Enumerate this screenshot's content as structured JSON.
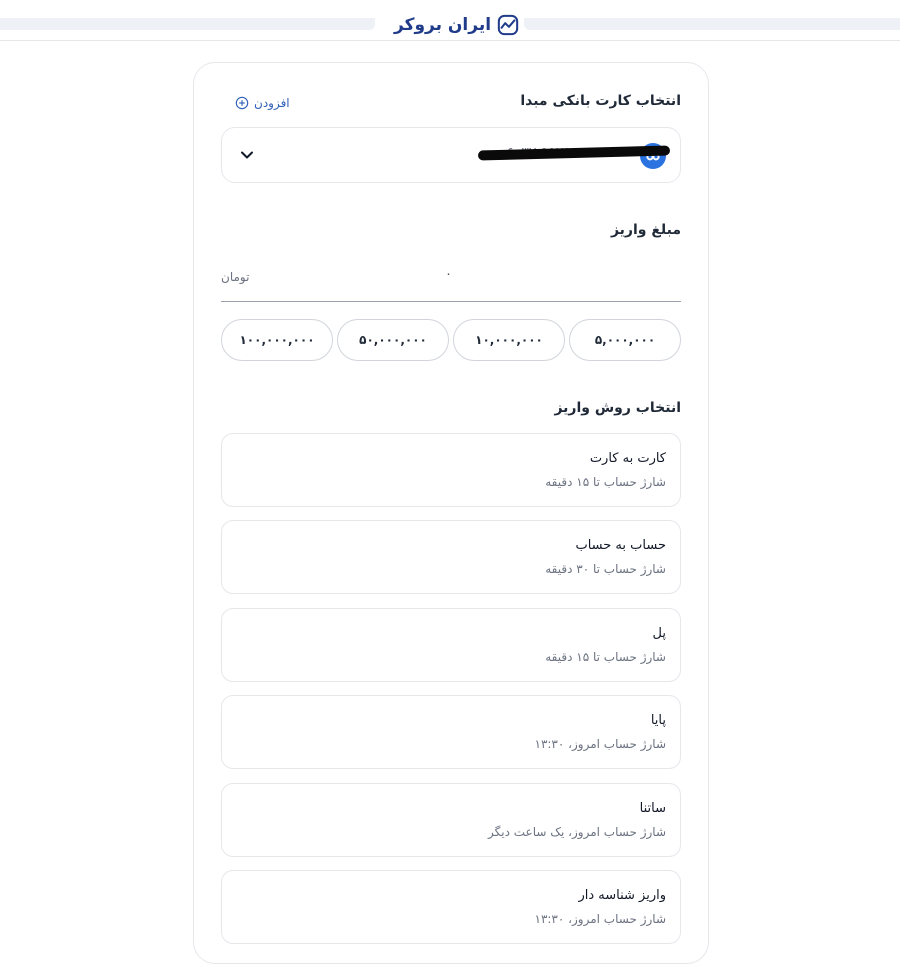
{
  "header": {
    "logo_text": "ایران بروکر",
    "logo_icon": "chart-trend-icon"
  },
  "source_card": {
    "title": "انتخاب کارت بانکی مبدا",
    "add_label": "افزودن",
    "card_number_masked": "۶۰۳۷ ۹۹۷۹ ۰۰۰۰ ۰۰۰۰",
    "bank_icon": "bank-logo-icon"
  },
  "deposit_amount": {
    "title": "مبلغ واریز",
    "value": "۰",
    "unit": "تومان",
    "presets": [
      "۵,۰۰۰,۰۰۰",
      "۱۰,۰۰۰,۰۰۰",
      "۵۰,۰۰۰,۰۰۰",
      "۱۰۰,۰۰۰,۰۰۰"
    ]
  },
  "deposit_method": {
    "title": "انتخاب روش واریز",
    "options": [
      {
        "name": "کارت به کارت",
        "desc": "شارژ حساب تا ۱۵ دقیقه"
      },
      {
        "name": "حساب به حساب",
        "desc": "شارژ حساب تا ۳۰ دقیقه"
      },
      {
        "name": "پل",
        "desc": "شارژ حساب تا ۱۵ دقیقه"
      },
      {
        "name": "پایا",
        "desc": "شارژ حساب امروز، ۱۳:۳۰"
      },
      {
        "name": "ساتنا",
        "desc": "شارژ حساب امروز، یک ساعت دیگر"
      },
      {
        "name": "واریز شناسه دار",
        "desc": "شارژ حساب امروز، ۱۳:۳۰"
      }
    ]
  },
  "colors": {
    "accent": "#2f5fb8",
    "brand": "#1f3b8a",
    "border": "#e5e7eb"
  }
}
